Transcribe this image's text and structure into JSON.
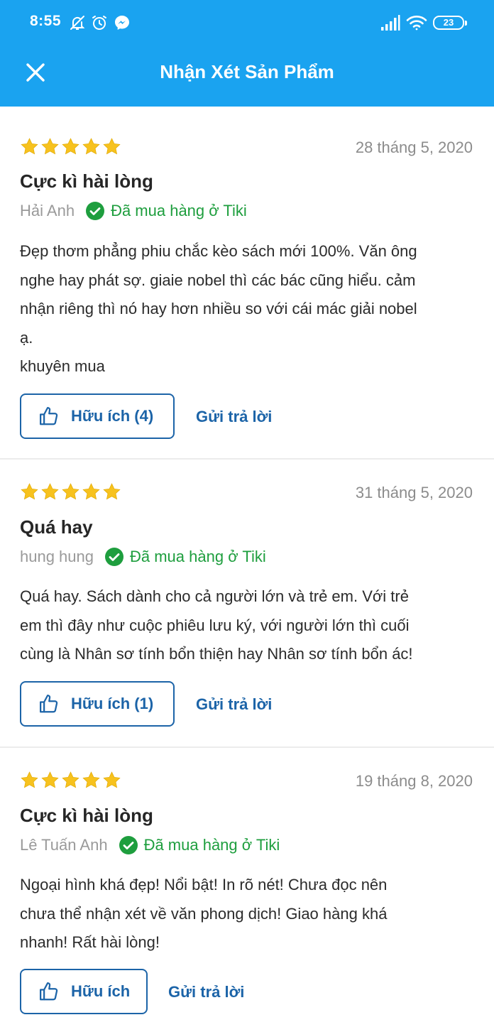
{
  "status_bar": {
    "time": "8:55",
    "battery": "23",
    "icons": [
      "mute-bell-icon",
      "alarm-icon",
      "messenger-icon",
      "signal-icon",
      "wifi-icon",
      "battery-icon"
    ]
  },
  "header": {
    "title": "Nhận Xét Sản Phẩm",
    "close_icon": "close-icon",
    "background_color": "#1aa3f0"
  },
  "colors": {
    "accent": "#1c64a8",
    "verified": "#1e9e3e",
    "star": "#f7c21e"
  },
  "reviews": [
    {
      "rating": 5,
      "date": "28 tháng 5, 2020",
      "title": "Cực kì hài lòng",
      "author": "Hải Anh",
      "verified": "Đã mua hàng ở Tiki",
      "body_lines": [
        "Đẹp thơm phẳng phiu chắc kèo sách mới 100%. Văn ông",
        "nghe hay phát sợ. giaie nobel thì các bác cũng hiểu. cảm",
        "nhận riêng thì nó hay hơn nhiều so với cái mác giải nobel",
        "ạ.",
        "khuyên mua"
      ],
      "helpful_label": "Hữu ích (4)",
      "reply_label": "Gửi trả lời"
    },
    {
      "rating": 5,
      "date": "31 tháng 5, 2020",
      "title": "Quá hay",
      "author": "hung hung",
      "verified": "Đã mua hàng ở Tiki",
      "body_lines": [
        "Quá hay. Sách dành cho cả người lớn và trẻ em. Với trẻ",
        "em thì đây như cuộc phiêu lưu ký, với người lớn thì cuối",
        "cùng là Nhân sơ tính bổn thiện hay Nhân sơ tính bổn ác!"
      ],
      "helpful_label": "Hữu ích (1)",
      "reply_label": "Gửi trả lời"
    },
    {
      "rating": 5,
      "date": "19 tháng 8, 2020",
      "title": "Cực kì hài lòng",
      "author": "Lê Tuấn Anh",
      "verified": "Đã mua hàng ở Tiki",
      "body_lines": [
        "Ngoại hình khá đẹp! Nổi bật! In rõ nét! Chưa đọc nên",
        "chưa thể nhận xét về văn phong dịch! Giao hàng khá",
        "nhanh! Rất hài lòng!"
      ],
      "helpful_label": "Hữu ích",
      "reply_label": "Gửi trả lời"
    }
  ]
}
